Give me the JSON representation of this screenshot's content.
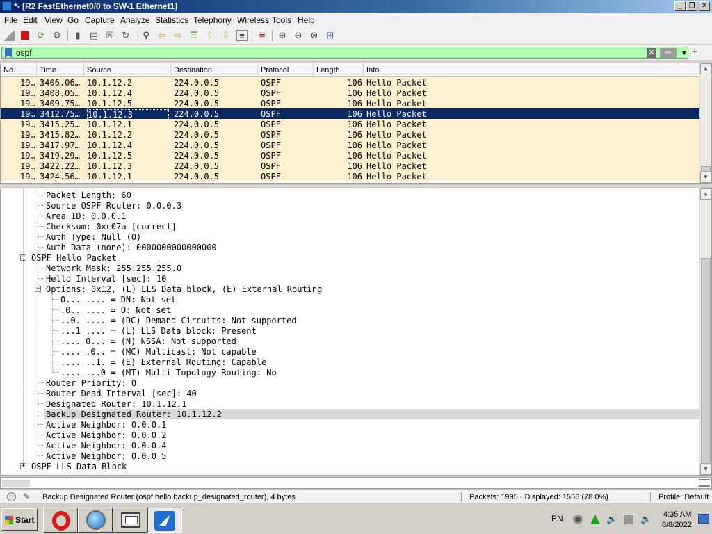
{
  "window": {
    "title": "*- [R2 FastEthernet0/0 to SW-1 Ethernet1]",
    "minimize_glyph": "_",
    "maximize_glyph": "❐",
    "close_glyph": "✕"
  },
  "menu": [
    "File",
    "Edit",
    "View",
    "Go",
    "Capture",
    "Analyze",
    "Statistics",
    "Telephony",
    "Wireless",
    "Tools",
    "Help"
  ],
  "toolbar_icons": [
    "shark-fin-icon",
    "stop-icon",
    "restart-icon",
    "options-icon",
    "open-icon",
    "save-icon",
    "close-file-icon",
    "reload-icon",
    "find-icon",
    "back-icon",
    "forward-icon",
    "goto-icon",
    "first-icon",
    "last-icon",
    "autoscroll-icon",
    "colorize-icon",
    "zoom-in-icon",
    "zoom-out-icon",
    "zoom-reset-icon",
    "resize-columns-icon"
  ],
  "filter": {
    "value": "ospf",
    "clear_glyph": "✕",
    "apply_glyph": "⇨",
    "dropdown_glyph": "▼",
    "add_glyph": "+"
  },
  "packet_list": {
    "columns": [
      "No.",
      "Time",
      "Source",
      "Destination",
      "Protocol",
      "Length",
      "Info"
    ],
    "rows": [
      {
        "no": "19…",
        "time": "3406.06…",
        "src": "10.1.12.2",
        "dst": "224.0.0.5",
        "proto": "OSPF",
        "len": "106",
        "info": "Hello Packet"
      },
      {
        "no": "19…",
        "time": "3408.05…",
        "src": "10.1.12.4",
        "dst": "224.0.0.5",
        "proto": "OSPF",
        "len": "106",
        "info": "Hello Packet"
      },
      {
        "no": "19…",
        "time": "3409.75…",
        "src": "10.1.12.5",
        "dst": "224.0.0.5",
        "proto": "OSPF",
        "len": "106",
        "info": "Hello Packet"
      },
      {
        "no": "19…",
        "time": "3412.75…",
        "src": "10.1.12.3",
        "dst": "224.0.0.5",
        "proto": "OSPF",
        "len": "106",
        "info": "Hello Packet",
        "selected": true
      },
      {
        "no": "19…",
        "time": "3415.25…",
        "src": "10.1.12.1",
        "dst": "224.0.0.5",
        "proto": "OSPF",
        "len": "106",
        "info": "Hello Packet"
      },
      {
        "no": "19…",
        "time": "3415.82…",
        "src": "10.1.12.2",
        "dst": "224.0.0.5",
        "proto": "OSPF",
        "len": "106",
        "info": "Hello Packet"
      },
      {
        "no": "19…",
        "time": "3417.97…",
        "src": "10.1.12.4",
        "dst": "224.0.0.5",
        "proto": "OSPF",
        "len": "106",
        "info": "Hello Packet"
      },
      {
        "no": "19…",
        "time": "3419.29…",
        "src": "10.1.12.5",
        "dst": "224.0.0.5",
        "proto": "OSPF",
        "len": "106",
        "info": "Hello Packet"
      },
      {
        "no": "19…",
        "time": "3422.22…",
        "src": "10.1.12.3",
        "dst": "224.0.0.5",
        "proto": "OSPF",
        "len": "106",
        "info": "Hello Packet"
      },
      {
        "no": "19…",
        "time": "3424.56…",
        "src": "10.1.12.1",
        "dst": "224.0.0.5",
        "proto": "OSPF",
        "len": "106",
        "info": "Hello Packet"
      }
    ]
  },
  "details": [
    {
      "text": "Packet Length: 60",
      "level": 2
    },
    {
      "text": "Source OSPF Router: 0.0.0.3",
      "level": 2
    },
    {
      "text": "Area ID: 0.0.0.1",
      "level": 2
    },
    {
      "text": "Checksum: 0xc07a [correct]",
      "level": 2
    },
    {
      "text": "Auth Type: Null (0)",
      "level": 2
    },
    {
      "text": "Auth Data (none): 0000000000000000",
      "level": 2
    },
    {
      "text": "OSPF Hello Packet",
      "level": 1,
      "expander": "−"
    },
    {
      "text": "Network Mask: 255.255.255.0",
      "level": 2
    },
    {
      "text": "Hello Interval [sec]: 10",
      "level": 2
    },
    {
      "text": "Options: 0x12, (L) LLS Data block, (E) External Routing",
      "level": 2,
      "expander": "−"
    },
    {
      "text": "0... .... = DN: Not set",
      "level": 3
    },
    {
      "text": ".0.. .... = O: Not set",
      "level": 3
    },
    {
      "text": "..0. .... = (DC) Demand Circuits: Not supported",
      "level": 3
    },
    {
      "text": "...1 .... = (L) LLS Data block: Present",
      "level": 3
    },
    {
      "text": ".... 0... = (N) NSSA: Not supported",
      "level": 3
    },
    {
      "text": ".... .0.. = (MC) Multicast: Not capable",
      "level": 3
    },
    {
      "text": ".... ..1. = (E) External Routing: Capable",
      "level": 3
    },
    {
      "text": ".... ...0 = (MT) Multi-Topology Routing: No",
      "level": 3
    },
    {
      "text": "Router Priority: 0",
      "level": 2
    },
    {
      "text": "Router Dead Interval [sec]: 40",
      "level": 2
    },
    {
      "text": "Designated Router: 10.1.12.1",
      "level": 2
    },
    {
      "text": "Backup Designated Router: 10.1.12.2",
      "level": 2,
      "highlight": true
    },
    {
      "text": "Active Neighbor: 0.0.0.1",
      "level": 2
    },
    {
      "text": "Active Neighbor: 0.0.0.2",
      "level": 2
    },
    {
      "text": "Active Neighbor: 0.0.0.4",
      "level": 2
    },
    {
      "text": "Active Neighbor: 0.0.0.5",
      "level": 2
    },
    {
      "text": "OSPF LLS Data Block",
      "level": 1,
      "expander": "+"
    }
  ],
  "scroll_glyphs": {
    "up": "▲",
    "down": "▼"
  },
  "status": {
    "field": "Backup Designated Router (ospf.hello.backup_designated_router), 4 bytes",
    "packets": "Packets: 1995 · Displayed: 1556 (78.0%)",
    "profile": "Profile: Default",
    "edit_glyph": "✎"
  },
  "taskbar": {
    "start_label": "Start",
    "apps": [
      "opera-icon",
      "browser-globe-icon",
      "network-icon",
      "wireshark-icon"
    ],
    "language": "EN",
    "clock_time": "4:35 AM",
    "clock_date": "8/8/2022"
  },
  "colors": {
    "selected_row": "#0b2a63",
    "row_background": "#fdf0d0",
    "filter_valid": "#afffaf",
    "title_bar": "#0a246a"
  }
}
